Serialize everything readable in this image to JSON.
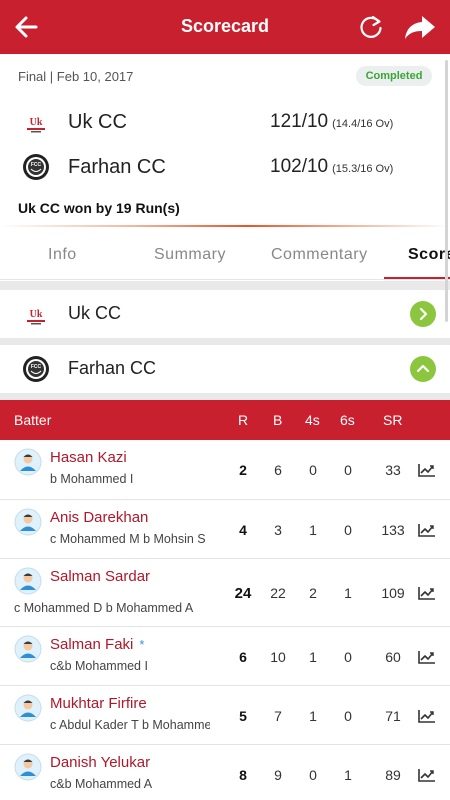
{
  "header": {
    "title": "Scorecard"
  },
  "match": {
    "meta": "Final | Feb 10, 2017",
    "status": "Completed",
    "teams": [
      {
        "name": "Uk CC",
        "score": "121/10",
        "overs": "(14.4/16 Ov)",
        "logo_text": "Uk"
      },
      {
        "name": "Farhan CC",
        "score": "102/10",
        "overs": "(15.3/16 Ov)",
        "logo_text": "FCC"
      }
    ],
    "result": "Uk CC won by 19 Run(s)"
  },
  "tabs": [
    "Info",
    "Summary",
    "Commentary",
    "Scorecard"
  ],
  "sections": [
    {
      "name": "Uk CC",
      "state": "collapsed"
    },
    {
      "name": "Farhan CC",
      "state": "expanded"
    }
  ],
  "batting": {
    "columns": [
      "Batter",
      "R",
      "B",
      "4s",
      "6s",
      "SR"
    ],
    "rows": [
      {
        "name": "Hasan Kazi",
        "dismissal": "b Mohammed I",
        "r": "2",
        "b": "6",
        "fours": "0",
        "sixes": "0",
        "sr": "33"
      },
      {
        "name": "Anis Darekhan",
        "dismissal": "c Mohammed M b Mohsin S",
        "r": "4",
        "b": "3",
        "fours": "1",
        "sixes": "0",
        "sr": "133"
      },
      {
        "name": "Salman Sardar",
        "dismissal": "c Mohammed D b Mohammed A",
        "r": "24",
        "b": "22",
        "fours": "2",
        "sixes": "1",
        "sr": "109"
      },
      {
        "name": "Salman Faki",
        "star": "*",
        "dismissal": "c&b Mohammed I",
        "r": "6",
        "b": "10",
        "fours": "1",
        "sixes": "0",
        "sr": "60"
      },
      {
        "name": "Mukhtar Firfire",
        "dismissal": "c Abdul Kader T b Mohamme",
        "r": "5",
        "b": "7",
        "fours": "1",
        "sixes": "0",
        "sr": "71"
      },
      {
        "name": "Danish Yelukar",
        "dismissal": "c&b Mohammed A",
        "r": "8",
        "b": "9",
        "fours": "0",
        "sixes": "1",
        "sr": "89"
      }
    ]
  },
  "colors": {
    "primary": "#c8202f",
    "accent_green": "#8cc63f",
    "status_green": "#3aa635",
    "batter_name": "#b0182a"
  },
  "icons": [
    "back-arrow-icon",
    "refresh-icon",
    "share-icon",
    "chevron-right-icon",
    "chevron-up-icon",
    "player-avatar-icon",
    "stats-trend-icon"
  ]
}
